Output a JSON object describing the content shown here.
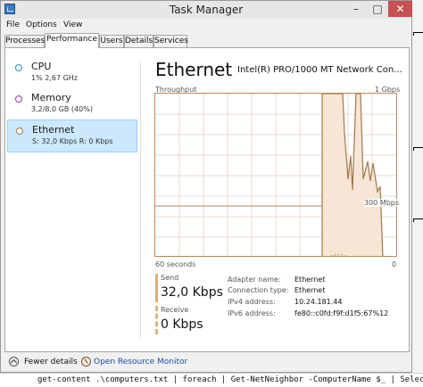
{
  "window": {
    "title": "Task Manager"
  },
  "menubar": [
    "File",
    "Options",
    "View"
  ],
  "tabs": [
    "Processes",
    "Performance",
    "Users",
    "Details",
    "Services"
  ],
  "active_tab": "Performance",
  "sidebar": [
    {
      "name": "CPU",
      "sub": "1% 2,67 GHz",
      "circle_color": "#1e90c8"
    },
    {
      "name": "Memory",
      "sub": "3,2/8,0 GB (40%)",
      "circle_color": "#8b3a9e"
    },
    {
      "name": "Ethernet",
      "sub": "S: 32,0 Kbps R: 0 Kbps",
      "circle_color": "#a0784b",
      "selected": true
    }
  ],
  "main": {
    "title": "Ethernet",
    "device": "Intel(R) PRO/1000 MT Network Con...",
    "throughput_label": "Throughput",
    "max_label": "1 Gbps",
    "ref_label": "300 Mbps",
    "time_left": "60 seconds",
    "time_right": "0"
  },
  "stats": {
    "send_label": "Send",
    "send_value": "32,0 Kbps",
    "receive_label": "Receive",
    "receive_value": "0 Kbps"
  },
  "info": [
    {
      "label": "Adapter name:",
      "value": "Ethernet"
    },
    {
      "label": "Connection type:",
      "value": "Ethernet"
    },
    {
      "label": "IPv4 address:",
      "value": "10.24.181.44"
    },
    {
      "label": "IPv6 address:",
      "value": "fe80::c0fd:f9f:d1f5:67%12"
    }
  ],
  "footer": {
    "fewer_details": "Fewer details",
    "open_monitor": "Open Resource Monitor"
  },
  "background": {
    "terminal_text": "get-content .\\computers.txt | foreach | Get-NetNeighbor -ComputerName $_ | Select"
  },
  "colors": {
    "accent": "#a0784b",
    "graph_fill": "#f7e6d6",
    "graph_line": "#b5885c",
    "close_button": "#c75050",
    "selection": "#cce8ff"
  }
}
